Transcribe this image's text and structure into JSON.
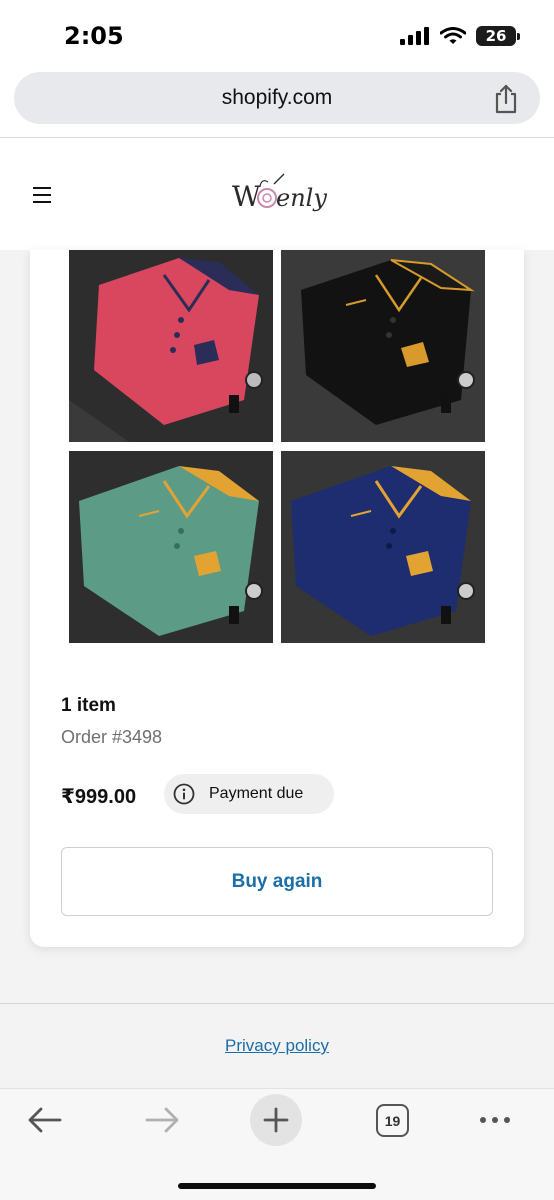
{
  "status_bar": {
    "time": "2:05",
    "battery": "26"
  },
  "browser": {
    "url": "shopify.com",
    "tab_count": "19"
  },
  "store": {
    "logo_text": "Wovenly"
  },
  "order": {
    "item_count": "1 item",
    "order_number": "Order #3498",
    "price": "₹999.00",
    "payment_status": "Payment due",
    "buy_again_label": "Buy again",
    "product_images": [
      {
        "shirt_color": "#d9475f",
        "collar_color": "#2a2d58",
        "accent": "#2a2d58"
      },
      {
        "shirt_color": "#121212",
        "collar_color": "#1a1a1a",
        "accent": "#d89a2a"
      },
      {
        "shirt_color": "#5c9c86",
        "collar_color": "#e3a333",
        "accent": "#e3a333"
      },
      {
        "shirt_color": "#1e2d70",
        "collar_color": "#e3a333",
        "accent": "#e3a333"
      }
    ]
  },
  "footer": {
    "privacy_label": "Privacy policy"
  },
  "colors": {
    "link": "#1b6ea8",
    "badge_bg": "#efefef",
    "url_bar_bg": "#e8e9ec"
  }
}
